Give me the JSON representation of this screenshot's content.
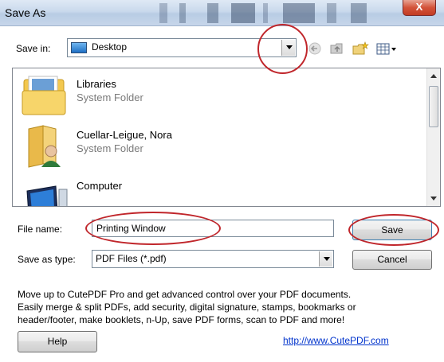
{
  "window": {
    "title": "Save As",
    "close_glyph": "X"
  },
  "save_in": {
    "label": "Save in:",
    "value": "Desktop"
  },
  "toolbar": {
    "icons": [
      "back-arrow-icon",
      "up-folder-icon",
      "new-folder-icon",
      "views-menu-icon"
    ]
  },
  "file_list": {
    "items": [
      {
        "name": "Libraries",
        "type": "System Folder",
        "icon": "libraries-folder-icon"
      },
      {
        "name": "Cuellar-Leigue, Nora",
        "type": "System Folder",
        "icon": "user-folder-icon"
      },
      {
        "name": "Computer",
        "type": "",
        "icon": "computer-icon"
      }
    ]
  },
  "file_name": {
    "label": "File name:",
    "value": "Printing Window"
  },
  "save_as_type": {
    "label": "Save as type:",
    "value": "PDF Files (*.pdf)"
  },
  "buttons": {
    "save": "Save",
    "cancel": "Cancel",
    "help": "Help"
  },
  "promo": {
    "lines": [
      "Move up to CutePDF Pro and get advanced control over your PDF documents.",
      "Easily merge & split PDFs, add security, digital signature, stamps, bookmarks or",
      "header/footer, make booklets, n-Up, save PDF forms, scan to PDF and more!"
    ],
    "link": "http://www.CutePDF.com"
  },
  "annotation_color": "#c0262b"
}
